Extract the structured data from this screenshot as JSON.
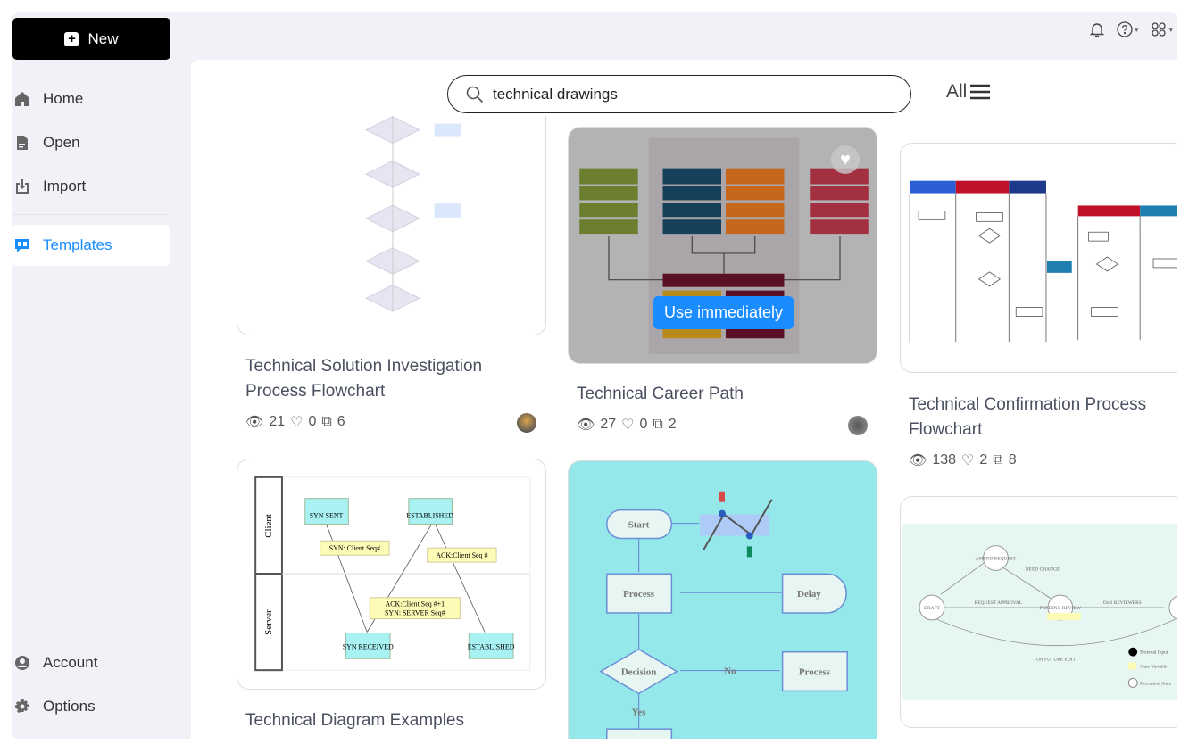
{
  "sidebar": {
    "new_label": "New",
    "items": [
      {
        "label": "Home",
        "icon": "home-icon"
      },
      {
        "label": "Open",
        "icon": "file-icon"
      },
      {
        "label": "Import",
        "icon": "import-icon"
      },
      {
        "label": "Templates",
        "icon": "templates-icon",
        "active": true
      }
    ],
    "bottom": [
      {
        "label": "Account",
        "icon": "account-icon"
      },
      {
        "label": "Options",
        "icon": "gear-icon"
      }
    ]
  },
  "header": {
    "icons": [
      "bell-icon",
      "help-icon",
      "apps-icon"
    ]
  },
  "search": {
    "value": "technical drawings",
    "filter_label": "All"
  },
  "colors": {
    "accent": "#1a8cff",
    "career_bg": "#b3b3b3",
    "flow_bg": "#95e8ea",
    "state_bg": "#e6f6f2"
  },
  "cards": [
    {
      "title": "Technical Solution Investigation Process Flowchart",
      "views": "21",
      "likes": "0",
      "copies": "6"
    },
    {
      "title": "Technical Career Path",
      "views": "27",
      "likes": "0",
      "copies": "2",
      "hover_button": "Use immediately"
    },
    {
      "title": "Technical Confirmation Process Flowchart",
      "views": "138",
      "likes": "2",
      "copies": "8"
    },
    {
      "title": "Technical Diagram Examples"
    },
    {
      "title": ""
    },
    {
      "title": ""
    }
  ],
  "thumbs": {
    "tcp": {
      "lanes": [
        "Client",
        "Server"
      ],
      "nodes": [
        "SYN SENT",
        "ESTABLISHED",
        "SYN RECEIVED",
        "ESTABLISHED"
      ],
      "msgs": [
        "SYN: Client Seq#",
        "ACK:Client Seq #",
        "ACK:Client Seq #+1",
        "SYN: SERVER Seq#"
      ]
    },
    "flow": {
      "start": "Start",
      "process": "Process",
      "delay": "Delay",
      "decision": "Decision",
      "no": "No",
      "yes": "Yes",
      "process2": "Process"
    },
    "state": {
      "draft": "DRAFT",
      "amend": "AMEND REQUEST",
      "pending": "PENDING REVIEW",
      "request": "REQUEST APPROVAL",
      "need": "NEED CHANGE",
      "onn": "OnN REVIEWERS",
      "future": "ON FUTURE EDIT",
      "legend": [
        "External Input",
        "State Variable",
        "Document State"
      ]
    }
  }
}
